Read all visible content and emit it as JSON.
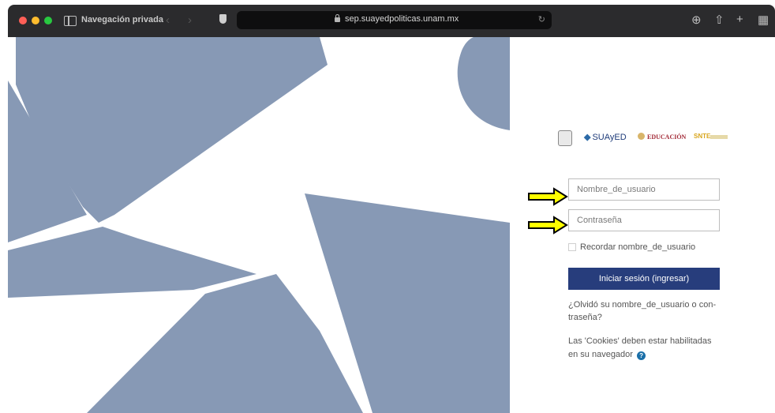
{
  "browser": {
    "tab_title": "Navegación privada",
    "url": "sep.suayedpoliticas.unam.mx",
    "icons": [
      "sidebar-icon",
      "back-icon",
      "forward-icon",
      "shield-icon",
      "lock-icon",
      "reload-icon",
      "download-icon",
      "share-icon",
      "new-tab-icon",
      "tab-overview-icon"
    ]
  },
  "logos": {
    "suayed": "SUAyED",
    "educacion": "EDUCACIÓN",
    "snte": "SNTE"
  },
  "login": {
    "username_placeholder": "Nombre_de_usuario",
    "password_placeholder": "Contraseña",
    "remember_label": "Recordar nombre_de_usuario",
    "submit_label": "Iniciar sesión (ingresar)",
    "forgot_link": "¿Olvidó su nombre_de_usuario o con-traseña?",
    "cookies_notice": "Las 'Cookies' deben estar habilitadas en su navegador"
  },
  "colors": {
    "hero_shape": "#8799b5",
    "login_button": "#273d7c",
    "annotation_arrow": "#ffff00"
  }
}
